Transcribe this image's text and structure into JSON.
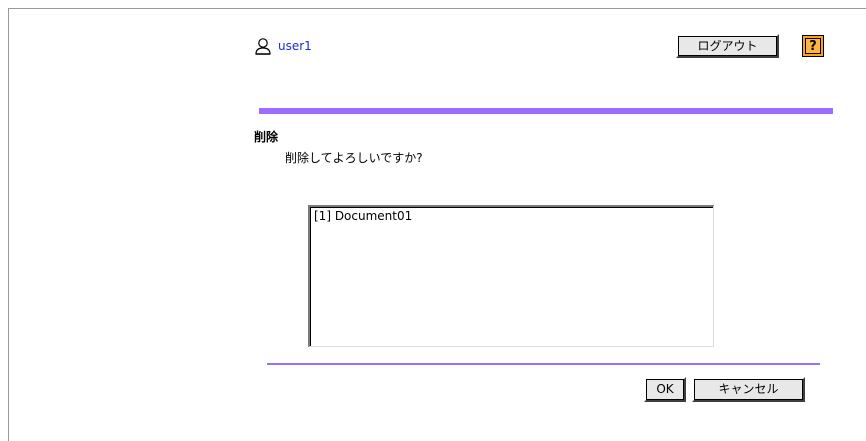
{
  "header": {
    "user_name": "user1",
    "user_icon": "user-icon",
    "logout_label": "ログアウト",
    "help_label": "?",
    "help_icon": "help-icon"
  },
  "accent_color": "#9d6dff",
  "dialog": {
    "title": "削除",
    "message": "削除してよろしいですか?",
    "items": [
      "[1] Document01"
    ]
  },
  "actions": {
    "ok_label": "OK",
    "cancel_label": "キャンセル"
  }
}
